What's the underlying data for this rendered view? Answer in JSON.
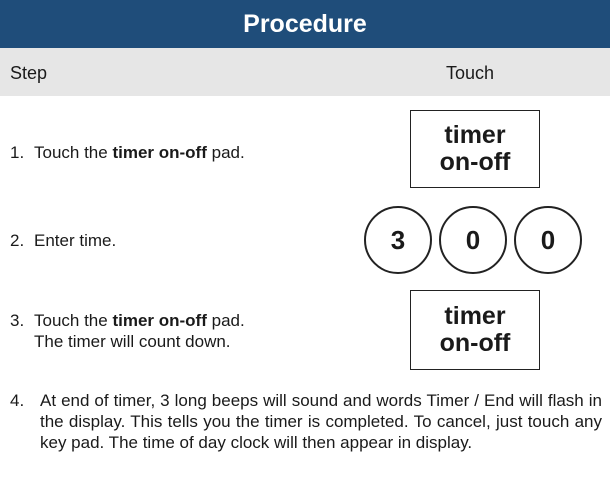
{
  "header": {
    "title": "Procedure"
  },
  "columns": {
    "step": "Step",
    "touch": "Touch"
  },
  "steps": [
    {
      "num": "1.",
      "pre": "Touch the ",
      "bold": "timer on-off",
      "post": " pad."
    },
    {
      "num": "2.",
      "text": "Enter time."
    },
    {
      "num": "3.",
      "pre": "Touch the ",
      "bold": "timer on-off",
      "post": " pad.",
      "line2": "The timer will count down."
    },
    {
      "num": "4.",
      "text": "At end of timer, 3 long beeps will sound and words Timer / End will flash in the display. This tells you the timer is completed. To cancel, just touch any key pad. The time of day clock will then appear in display."
    }
  ],
  "pads": {
    "timer1": {
      "line1": "timer",
      "line2": "on-off"
    },
    "digits": [
      "3",
      "0",
      "0"
    ],
    "timer2": {
      "line1": "timer",
      "line2": "on-off"
    }
  }
}
